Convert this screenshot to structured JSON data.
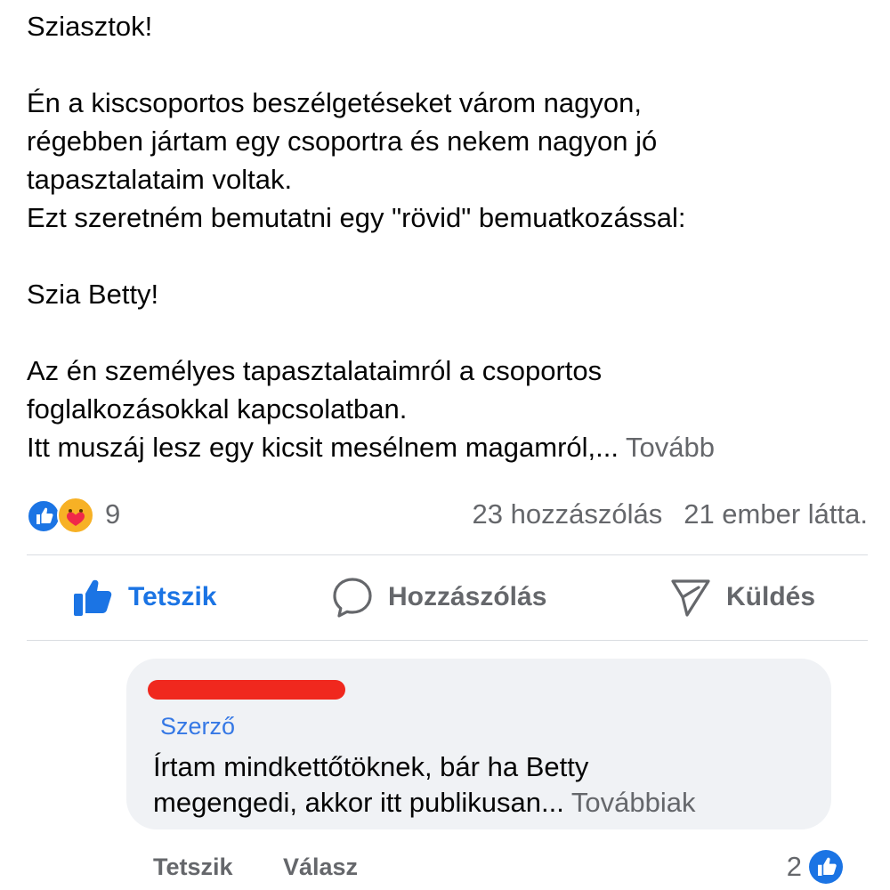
{
  "post": {
    "lines": [
      "Sziasztok!",
      "",
      "Én a kiscsoportos beszélgetéseket várom nagyon,",
      "régebben jártam egy csoportra és nekem nagyon jó",
      "tapasztalataim voltak.",
      "Ezt szeretném bemutatni egy \"rövid\" bemuatkozással:",
      "",
      "Szia Betty!",
      "",
      "Az én személyes tapasztalataimról a csoportos",
      "foglalkozásokkal kapcsolatban."
    ],
    "last_line": "Itt muszáj lesz egy kicsit mesélnem magamról,...",
    "see_more": "Tovább"
  },
  "reactions": {
    "count": "9",
    "icons": [
      "like-icon",
      "care-icon"
    ],
    "comments": "23 hozzászólás",
    "views": "21 ember látta."
  },
  "actions": {
    "like": "Tetszik",
    "comment": "Hozzászólás",
    "send": "Küldés"
  },
  "comment": {
    "badge": "Szerző",
    "lines": [
      "Írtam mindkettőtöknek, bár ha Betty"
    ],
    "last_line": "megengedi, akkor itt publikusan...",
    "see_more": "Továbbiak",
    "like": "Tetszik",
    "reply": "Válasz",
    "reaction_count": "2"
  },
  "colors": {
    "accent": "#1b74e4",
    "muted": "#65676b",
    "bubble": "#f0f2f5",
    "redaction": "#f0281e"
  }
}
